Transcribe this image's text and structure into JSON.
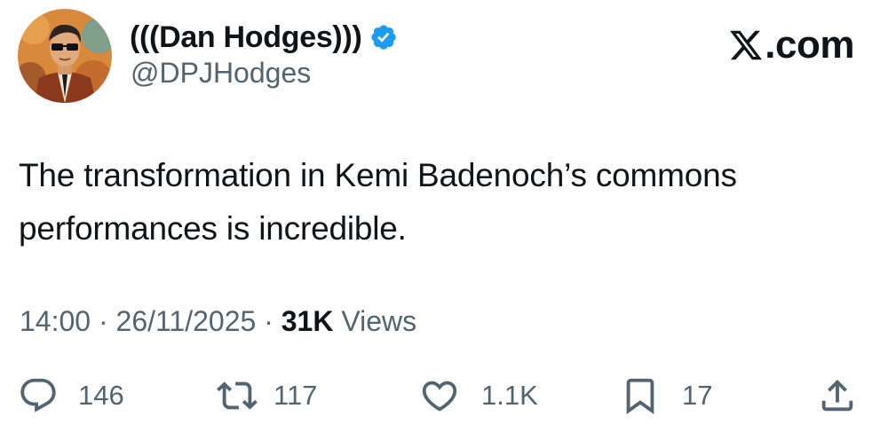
{
  "author": {
    "display_name": "(((Dan Hodges)))",
    "handle": "@DPJHodges",
    "verified": true,
    "verified_icon": "verified-badge-icon",
    "avatar_icon": "avatar"
  },
  "brand": {
    "logo_icon": "x-logo-icon",
    "label": ".com"
  },
  "tweet": {
    "text": "The transformation in Kemi Badenoch’s commons performances is incredible.",
    "time": "14:00",
    "separator_1": " · ",
    "date": "26/11/2025",
    "separator_2": " · ",
    "views_count": "31K",
    "views_label": " Views"
  },
  "actions": {
    "reply": {
      "icon": "reply-icon",
      "count": "146"
    },
    "repost": {
      "icon": "repost-icon",
      "count": "117"
    },
    "like": {
      "icon": "heart-icon",
      "count": "1.1K"
    },
    "bookmark": {
      "icon": "bookmark-icon",
      "count": "17"
    },
    "share": {
      "icon": "share-icon"
    }
  },
  "colors": {
    "text": "#0f1419",
    "secondary": "#536471",
    "verified_blue": "#1d9bf0",
    "background": "#ffffff"
  }
}
